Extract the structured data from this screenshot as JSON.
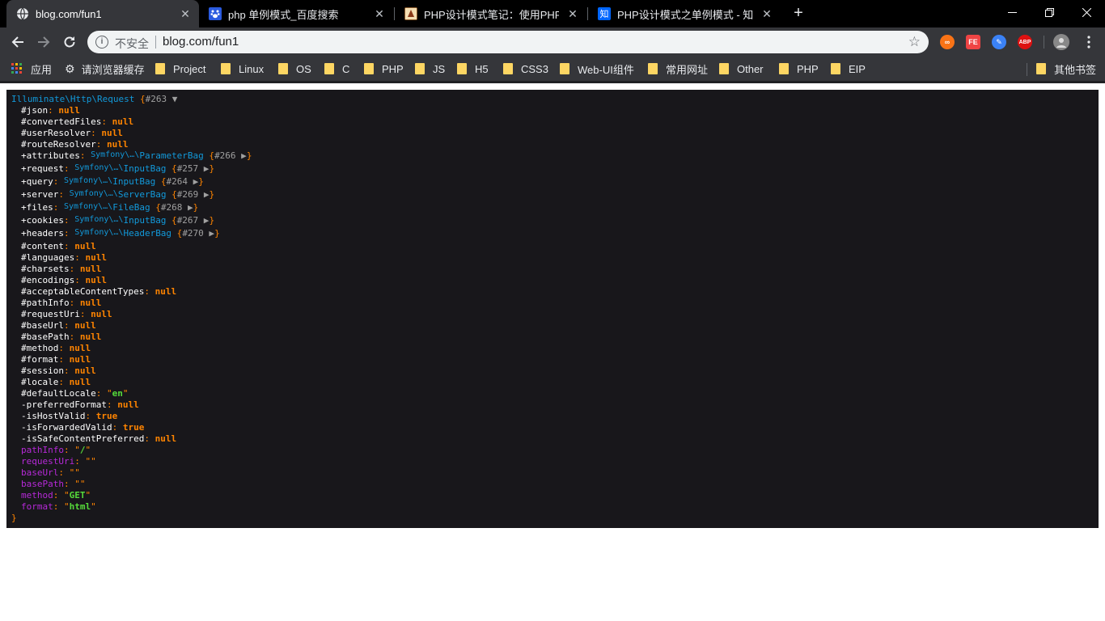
{
  "tabs": [
    {
      "title": "blog.com/fun1",
      "active": true,
      "favicon": "globe-icon"
    },
    {
      "title": "php 单例模式_百度搜索",
      "favicon": "baidu-paw-icon"
    },
    {
      "title": "PHP设计模式笔记：使用PHP实现",
      "favicon": "php-blog-icon"
    },
    {
      "title": "PHP设计模式之单例模式 - 知乎",
      "favicon": "zhihu-icon",
      "favicon_text": "知"
    }
  ],
  "toolbar": {
    "insecure_label": "不安全",
    "url": "blog.com/fun1"
  },
  "extensions": [
    {
      "name": "infinity-extension-icon",
      "color": "#f97316",
      "text": "∞"
    },
    {
      "name": "fe-helper-extension-icon",
      "color": "#ef4444",
      "text": "FE"
    },
    {
      "name": "color-picker-extension-icon",
      "color": "#3b82f6",
      "text": "✎"
    },
    {
      "name": "adblock-plus-extension-icon",
      "color": "#d11",
      "text": "ABP"
    }
  ],
  "bookmarks": [
    {
      "label": "应用",
      "icon": "apps-grid-icon"
    },
    {
      "label": "请浏览器缓存",
      "icon": "gear-icon"
    },
    {
      "label": "Project",
      "icon": "folder-icon"
    },
    {
      "label": "Linux",
      "icon": "folder-icon"
    },
    {
      "label": "OS",
      "icon": "folder-icon"
    },
    {
      "label": "C",
      "icon": "folder-icon"
    },
    {
      "label": "PHP",
      "icon": "folder-icon"
    },
    {
      "label": "JS",
      "icon": "folder-icon"
    },
    {
      "label": "H5",
      "icon": "folder-icon"
    },
    {
      "label": "CSS3",
      "icon": "folder-icon"
    },
    {
      "label": "Web-UI组件",
      "icon": "folder-icon"
    },
    {
      "label": "常用网址",
      "icon": "folder-icon"
    },
    {
      "label": "Other",
      "icon": "folder-icon"
    },
    {
      "label": "PHP",
      "icon": "folder-icon"
    },
    {
      "label": "EIP",
      "icon": "folder-icon"
    },
    {
      "label": "其他书签",
      "icon": "folder-icon"
    }
  ],
  "dump": {
    "class": "Illuminate\\Http\\Request",
    "open": " {",
    "ref": "#263",
    "toggle": "▼",
    "close": "}",
    "lines": [
      {
        "prefix": "#",
        "key": "json",
        "type": "null",
        "value": "null"
      },
      {
        "prefix": "#",
        "key": "convertedFiles",
        "type": "null",
        "value": "null"
      },
      {
        "prefix": "#",
        "key": "userResolver",
        "type": "null",
        "value": "null"
      },
      {
        "prefix": "#",
        "key": "routeResolver",
        "type": "null",
        "value": "null"
      },
      {
        "prefix": "+",
        "key": "attributes",
        "type": "object",
        "ns": "Symfony\\…\\",
        "cls": "ParameterBag",
        "ref": "#266"
      },
      {
        "prefix": "+",
        "key": "request",
        "type": "object",
        "ns": "Symfony\\…\\",
        "cls": "InputBag",
        "ref": "#257"
      },
      {
        "prefix": "+",
        "key": "query",
        "type": "object",
        "ns": "Symfony\\…\\",
        "cls": "InputBag",
        "ref": "#264"
      },
      {
        "prefix": "+",
        "key": "server",
        "type": "object",
        "ns": "Symfony\\…\\",
        "cls": "ServerBag",
        "ref": "#269"
      },
      {
        "prefix": "+",
        "key": "files",
        "type": "object",
        "ns": "Symfony\\…\\",
        "cls": "FileBag",
        "ref": "#268"
      },
      {
        "prefix": "+",
        "key": "cookies",
        "type": "object",
        "ns": "Symfony\\…\\",
        "cls": "InputBag",
        "ref": "#267"
      },
      {
        "prefix": "+",
        "key": "headers",
        "type": "object",
        "ns": "Symfony\\…\\",
        "cls": "HeaderBag",
        "ref": "#270"
      },
      {
        "prefix": "#",
        "key": "content",
        "type": "null",
        "value": "null"
      },
      {
        "prefix": "#",
        "key": "languages",
        "type": "null",
        "value": "null"
      },
      {
        "prefix": "#",
        "key": "charsets",
        "type": "null",
        "value": "null"
      },
      {
        "prefix": "#",
        "key": "encodings",
        "type": "null",
        "value": "null"
      },
      {
        "prefix": "#",
        "key": "acceptableContentTypes",
        "type": "null",
        "value": "null"
      },
      {
        "prefix": "#",
        "key": "pathInfo",
        "type": "null",
        "value": "null"
      },
      {
        "prefix": "#",
        "key": "requestUri",
        "type": "null",
        "value": "null"
      },
      {
        "prefix": "#",
        "key": "baseUrl",
        "type": "null",
        "value": "null"
      },
      {
        "prefix": "#",
        "key": "basePath",
        "type": "null",
        "value": "null"
      },
      {
        "prefix": "#",
        "key": "method",
        "type": "null",
        "value": "null"
      },
      {
        "prefix": "#",
        "key": "format",
        "type": "null",
        "value": "null"
      },
      {
        "prefix": "#",
        "key": "session",
        "type": "null",
        "value": "null"
      },
      {
        "prefix": "#",
        "key": "locale",
        "type": "null",
        "value": "null"
      },
      {
        "prefix": "#",
        "key": "defaultLocale",
        "type": "string",
        "value": "en"
      },
      {
        "prefix": "-",
        "key": "preferredFormat",
        "type": "null",
        "value": "null"
      },
      {
        "prefix": "-",
        "key": "isHostValid",
        "type": "bool",
        "value": "true"
      },
      {
        "prefix": "-",
        "key": "isForwardedValid",
        "type": "bool",
        "value": "true"
      },
      {
        "prefix": "-",
        "key": "isSafeContentPreferred",
        "type": "null",
        "value": "null"
      },
      {
        "prefix": "",
        "key": "pathInfo",
        "type": "vstring",
        "value": "/"
      },
      {
        "prefix": "",
        "key": "requestUri",
        "type": "vstring",
        "value": ""
      },
      {
        "prefix": "",
        "key": "baseUrl",
        "type": "vstring",
        "value": ""
      },
      {
        "prefix": "",
        "key": "basePath",
        "type": "vstring",
        "value": ""
      },
      {
        "prefix": "",
        "key": "method",
        "type": "vstring",
        "value": "GET"
      },
      {
        "prefix": "",
        "key": "format",
        "type": "vstring",
        "value": "html"
      }
    ]
  }
}
